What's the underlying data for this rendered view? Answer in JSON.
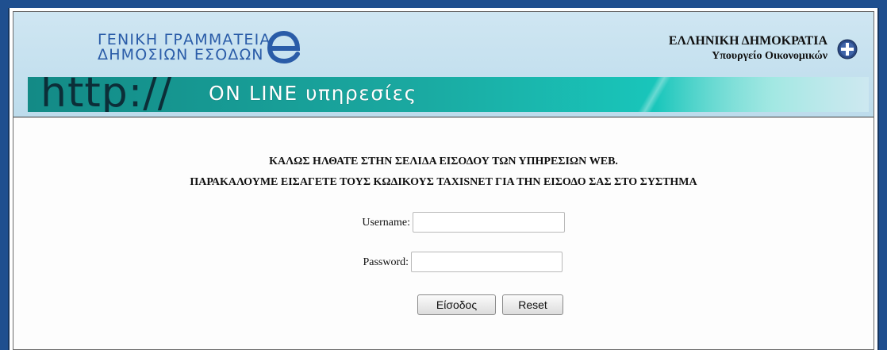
{
  "header": {
    "agency_line1": "ΓΕΝΙΚΗ ΓΡΑΜΜΑΤΕΙΑ",
    "agency_line2": "ΔΗΜΟΣΙΩΝ ΕΣΟΔΩΝ",
    "republic": "ΕΛΛΗΝΙΚΗ ΔΗΜΟΚΡΑΤΙΑ",
    "ministry": "Υπουργείο Οικονομικών",
    "banner_http": "http://",
    "banner_tagline": "ON LINE υπηρεσίες",
    "logo_icon": "e-logo-icon",
    "emblem_icon": "greek-emblem-icon"
  },
  "content": {
    "welcome_line1": "ΚΑΛΩΣ ΗΛΘΑΤΕ ΣΤΗΝ ΣΕΛΙΔΑ ΕΙΣΟΔΟΥ ΤΩΝ ΥΠΗΡΕΣΙΩΝ WEB.",
    "welcome_line2": "ΠΑΡΑΚΑΛΟΥΜΕ ΕΙΣΑΓΕΤΕ ΤΟΥΣ ΚΩΔΙΚΟΥΣ TAXISNET ΓΙΑ ΤΗΝ ΕΙΣΟΔΟ ΣΑΣ ΣΤΟ ΣΥΣΤΗΜΑ"
  },
  "form": {
    "username_label": "Username:",
    "username_value": "",
    "password_label": "Password:",
    "password_value": "",
    "login_label": "Είσοδος",
    "reset_label": "Reset"
  },
  "colors": {
    "page_border": "#1f4f8f",
    "header_bg": "#c6e1ef",
    "banner": "#1aa8a0",
    "agency_text": "#2a5ca8"
  }
}
